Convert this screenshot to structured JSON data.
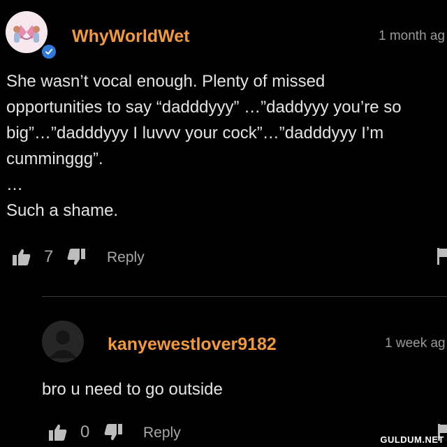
{
  "comment": {
    "username": "WhyWorldWet",
    "time": "1 month ag",
    "lines": [
      "She wasn’t vocal enough. Plenty of missed",
      "opportunities to say “dadddyyy” …”daddyyy you’re so",
      "big”…”dadddyyy I luvvv your cock”…”dadddyyy I’m",
      "cumminggg”.",
      "…",
      "Such a shame."
    ],
    "likes": "7",
    "reply_label": "Reply"
  },
  "reply": {
    "username": "kanyewestlover9182",
    "time": "1 week ag",
    "text": "bro u need to go outside",
    "likes": "0",
    "reply_label": "Reply"
  },
  "watermark": "GULDUM.NET",
  "colors": {
    "background": "#000000",
    "username": "#f29a3a",
    "verified_badge": "#2f7ad8",
    "muted_text": "#a8a8a8"
  }
}
